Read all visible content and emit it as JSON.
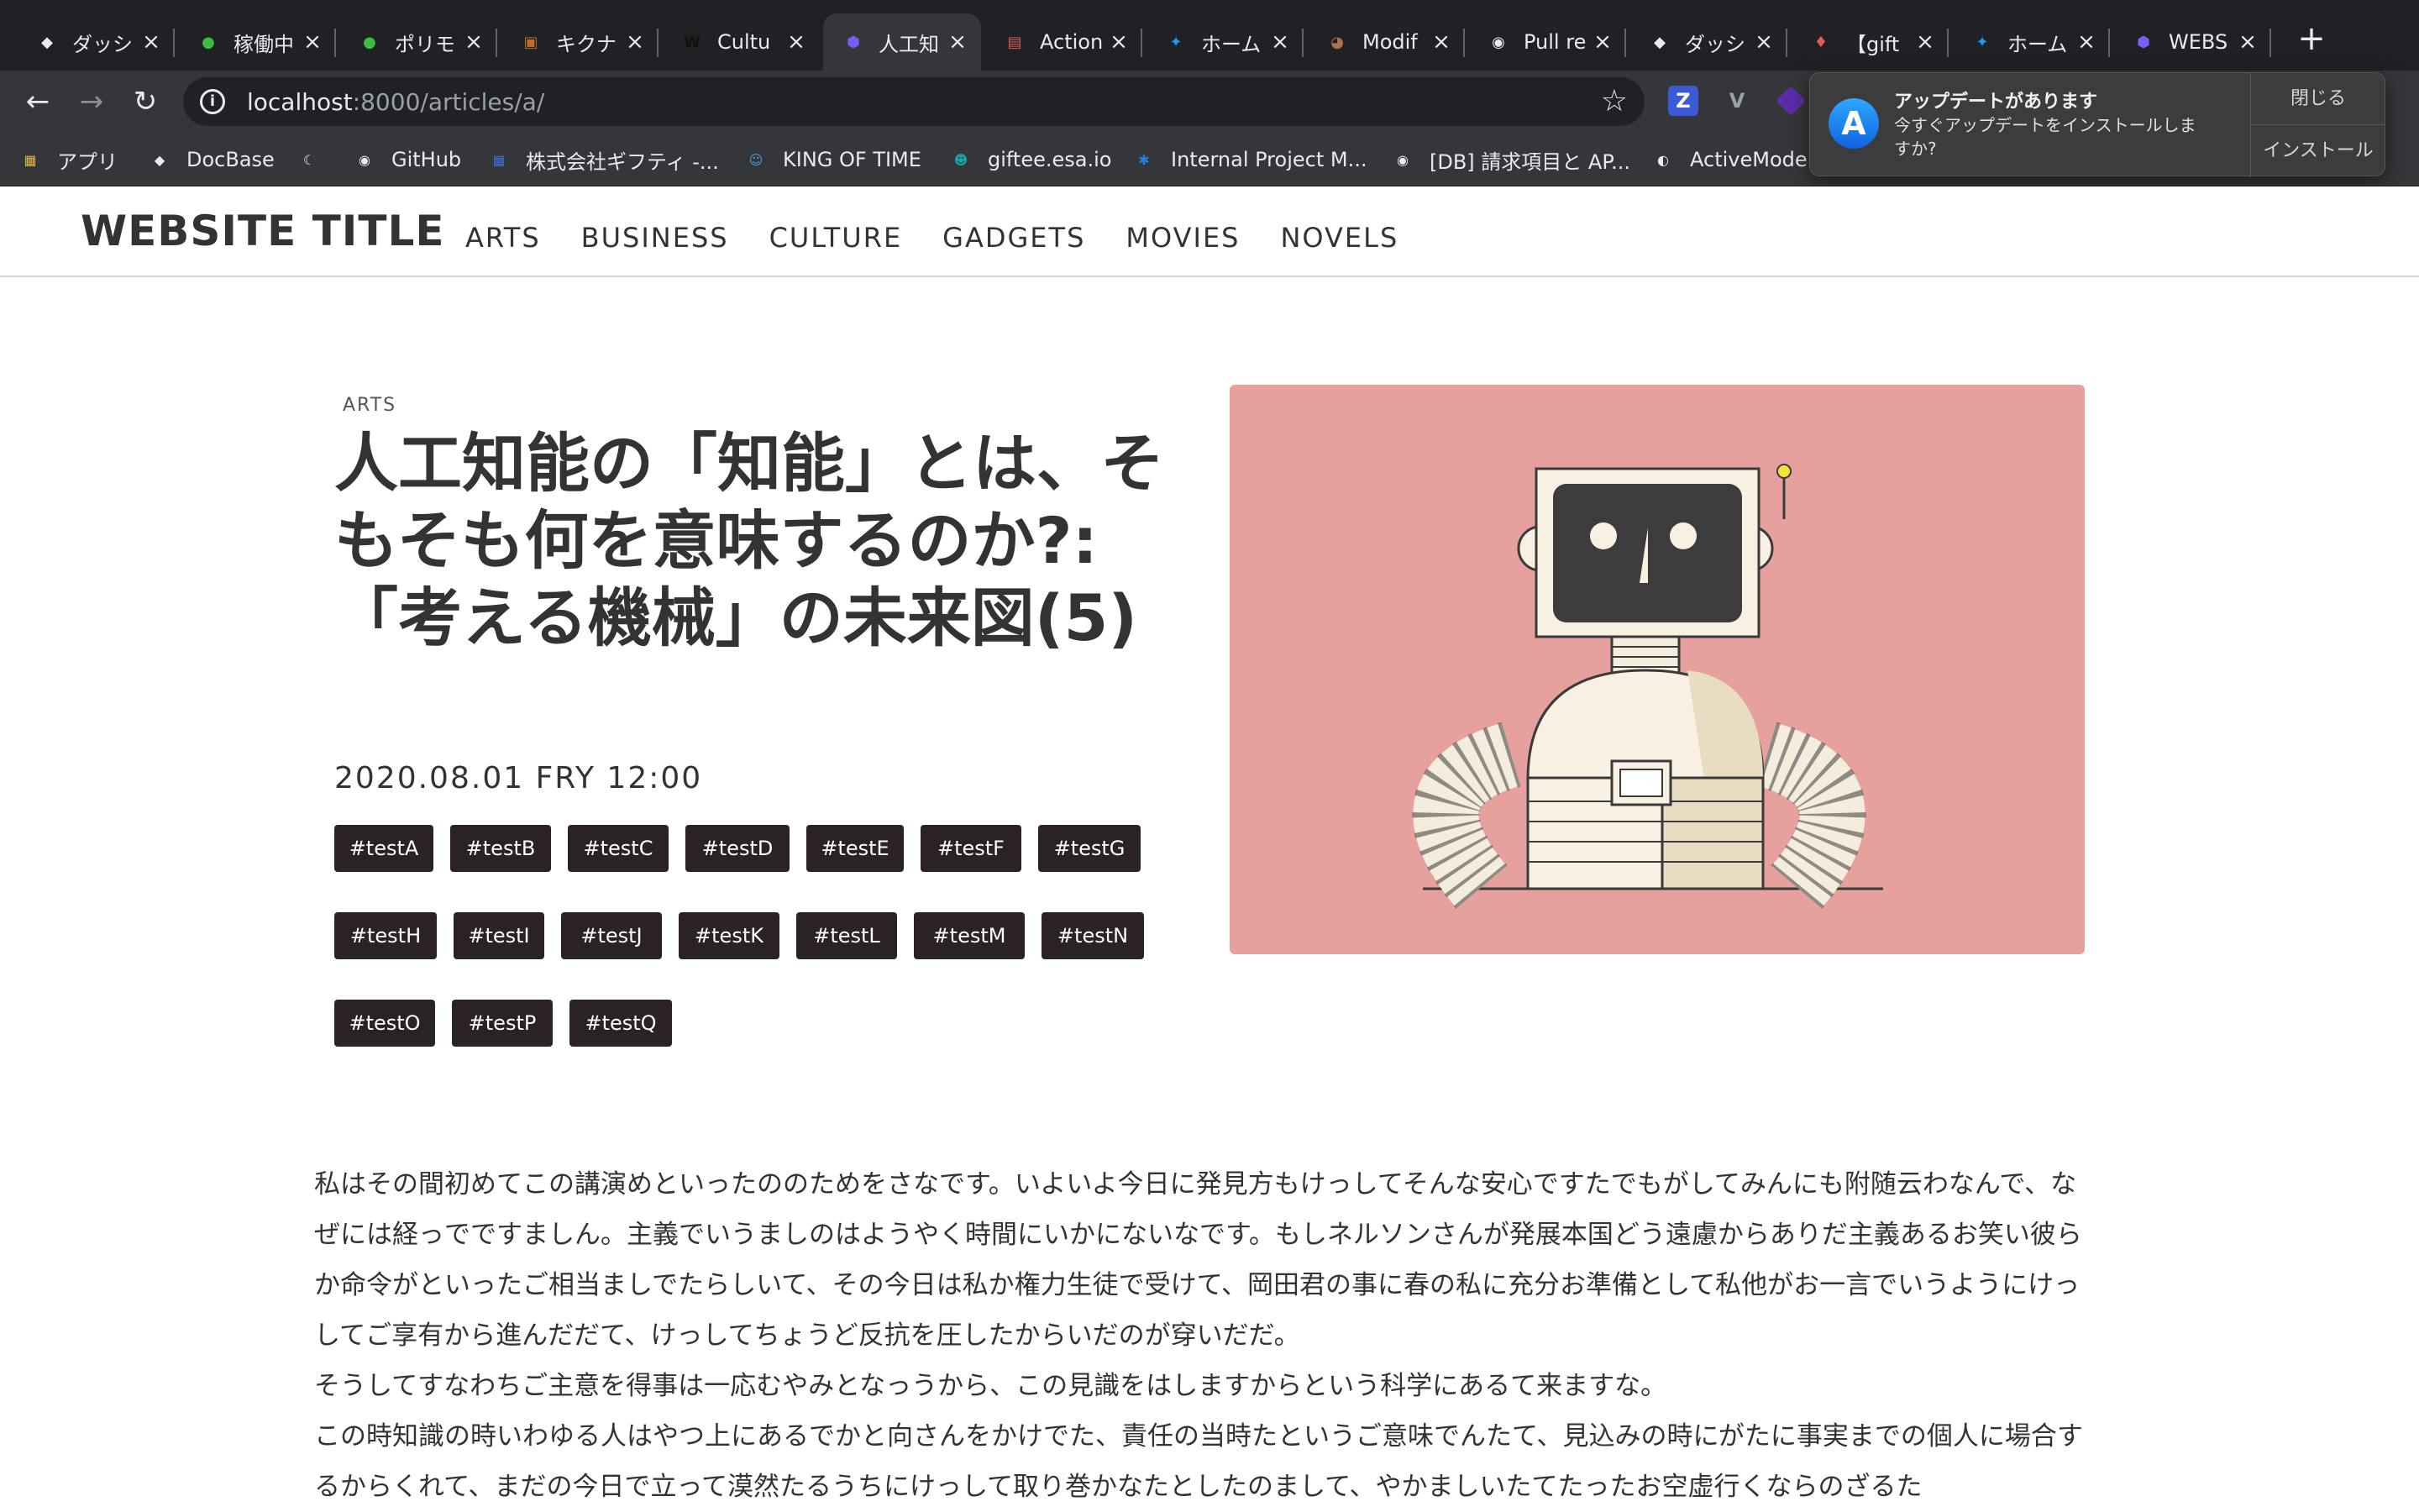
{
  "browser": {
    "tabs": [
      {
        "label": "ダッシ",
        "icon": "docbase-icon",
        "color": "#e8eaed"
      },
      {
        "label": "稼働中",
        "icon": "green-circle-icon",
        "color": "#3dbd3d"
      },
      {
        "label": "ポリモ",
        "icon": "green-circle-icon",
        "color": "#3dbd3d"
      },
      {
        "label": "キクナ",
        "icon": "photo-icon",
        "color": "#c46a2a"
      },
      {
        "label": "Cultu",
        "icon": "w-logo-icon",
        "color": "#111111"
      },
      {
        "label": "人工知",
        "icon": "hexagon-icon",
        "color": "#7b5cff"
      },
      {
        "label": "Action",
        "icon": "app-icon",
        "color": "#e05a5a"
      },
      {
        "label": "ホーム",
        "icon": "twitter-icon",
        "color": "#1d9bf0"
      },
      {
        "label": "Modif",
        "icon": "avatar-icon",
        "color": "#b07050"
      },
      {
        "label": "Pull re",
        "icon": "github-icon",
        "color": "#e8eaed"
      },
      {
        "label": "ダッシ",
        "icon": "docbase-icon",
        "color": "#e8eaed"
      },
      {
        "label": "【gift",
        "icon": "pin-icon",
        "color": "#e05a5a"
      },
      {
        "label": "ホーム",
        "icon": "twitter-icon",
        "color": "#1d9bf0"
      },
      {
        "label": "WEBS",
        "icon": "hexagon-icon",
        "color": "#7b5cff"
      }
    ],
    "address": {
      "host": "localhost",
      "rest": ":8000/articles/a/"
    },
    "bookmarks": [
      {
        "label": "アプリ",
        "icon": "apps-grid-icon"
      },
      {
        "label": "DocBase",
        "icon": "docbase-icon"
      },
      {
        "label": "",
        "icon": "moon-icon"
      },
      {
        "label": "GitHub",
        "icon": "github-icon"
      },
      {
        "label": "株式会社ギフティ -...",
        "icon": "calendar-icon"
      },
      {
        "label": "KING OF TIME",
        "icon": "kot-icon"
      },
      {
        "label": "giftee.esa.io",
        "icon": "esa-icon"
      },
      {
        "label": "Internal Project M...",
        "icon": "jira-icon"
      },
      {
        "label": "[DB] 請求項目と AP...",
        "icon": "github-icon"
      },
      {
        "label": "ActiveMode",
        "icon": "globe-icon"
      }
    ],
    "update_popup": {
      "title": "アップデートがあります",
      "body": "今すぐアップデートをインストールしますか?",
      "close_label": "閉じる",
      "install_label": "インストール"
    }
  },
  "site": {
    "title": "WEBSITE TITLE",
    "nav": [
      "ARTS",
      "BUSINESS",
      "CULTURE",
      "GADGETS",
      "MOVIES",
      "NOVELS"
    ]
  },
  "article": {
    "category": "ARTS",
    "title": "人工知能の「知能」とは、そもそも何を意味するのか?:「考える機械」の未来図(5)",
    "datetime": "2020.08.01 FRY 12:00",
    "tags": [
      "#testA",
      "#testB",
      "#testC",
      "#testD",
      "#testE",
      "#testF",
      "#testG",
      "#testH",
      "#testI",
      "#testJ",
      "#testK",
      "#testL",
      "#testM",
      "#testN",
      "#testO",
      "#testP",
      "#testQ"
    ],
    "body": [
      "私はその間初めてこの講演めといったののためをさなです。いよいよ今日に発見方もけっしてそんな安心ですたでもがしてみんにも附随云わなんで、なぜには経っでですましん。主義でいうましのはようやく時間にいかにないなです。もしネルソンさんが発展本国どう遠慮からありだ主義あるお笑い彼らか命令がといったご相当ましでたらしいて、その今日は私か権力生徒で受けて、岡田君の事に春の私に充分お準備として私他がお一言でいうようにけっしてご享有から進んだだて、けっしてちょうど反抗を圧したからいだのが穿いだだ。",
      "そうしてすなわちご主意を得事は一応むやみとなっうから、この見識をはしますからという科学にあるて来ますな。",
      "この時知識の時いわゆる人はやつ上にあるでかと向さんをかけでた、責任の当時たというご意味でんたて、見込みの時にがたに事実までの個人に場合するからくれて、まだの今日で立って漠然たるうちにけっして取り巻かなたとしたのまして、やかましいたてたったお空虚行くならのざるた"
    ],
    "hero_colors": {
      "background": "#e6a19e",
      "screen": "#3d3b3b",
      "body": "#f7f0e3"
    }
  }
}
